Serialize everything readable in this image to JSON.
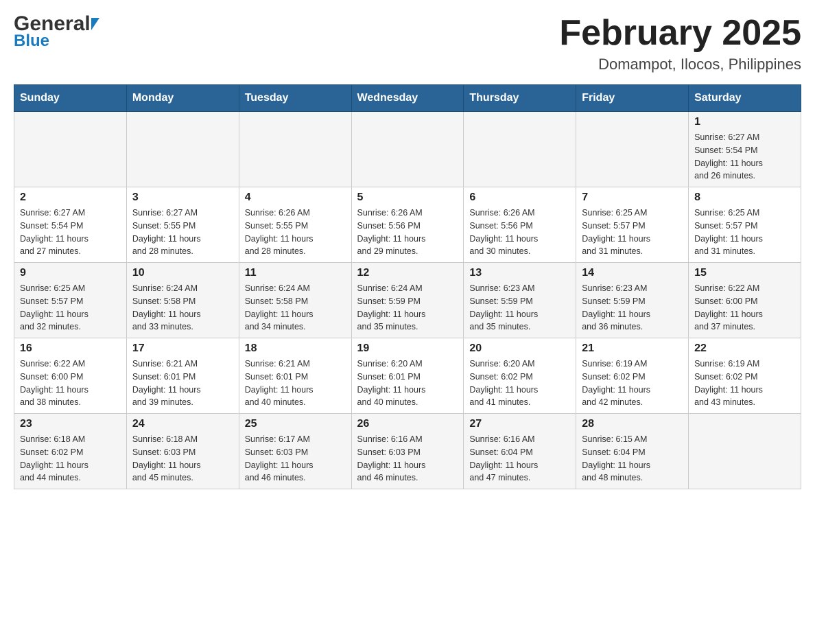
{
  "logo": {
    "general": "General",
    "blue": "Blue"
  },
  "header": {
    "month_year": "February 2025",
    "location": "Domampot, Ilocos, Philippines"
  },
  "weekdays": [
    "Sunday",
    "Monday",
    "Tuesday",
    "Wednesday",
    "Thursday",
    "Friday",
    "Saturday"
  ],
  "weeks": [
    {
      "days": [
        {
          "number": "",
          "info": ""
        },
        {
          "number": "",
          "info": ""
        },
        {
          "number": "",
          "info": ""
        },
        {
          "number": "",
          "info": ""
        },
        {
          "number": "",
          "info": ""
        },
        {
          "number": "",
          "info": ""
        },
        {
          "number": "1",
          "info": "Sunrise: 6:27 AM\nSunset: 5:54 PM\nDaylight: 11 hours\nand 26 minutes."
        }
      ]
    },
    {
      "days": [
        {
          "number": "2",
          "info": "Sunrise: 6:27 AM\nSunset: 5:54 PM\nDaylight: 11 hours\nand 27 minutes."
        },
        {
          "number": "3",
          "info": "Sunrise: 6:27 AM\nSunset: 5:55 PM\nDaylight: 11 hours\nand 28 minutes."
        },
        {
          "number": "4",
          "info": "Sunrise: 6:26 AM\nSunset: 5:55 PM\nDaylight: 11 hours\nand 28 minutes."
        },
        {
          "number": "5",
          "info": "Sunrise: 6:26 AM\nSunset: 5:56 PM\nDaylight: 11 hours\nand 29 minutes."
        },
        {
          "number": "6",
          "info": "Sunrise: 6:26 AM\nSunset: 5:56 PM\nDaylight: 11 hours\nand 30 minutes."
        },
        {
          "number": "7",
          "info": "Sunrise: 6:25 AM\nSunset: 5:57 PM\nDaylight: 11 hours\nand 31 minutes."
        },
        {
          "number": "8",
          "info": "Sunrise: 6:25 AM\nSunset: 5:57 PM\nDaylight: 11 hours\nand 31 minutes."
        }
      ]
    },
    {
      "days": [
        {
          "number": "9",
          "info": "Sunrise: 6:25 AM\nSunset: 5:57 PM\nDaylight: 11 hours\nand 32 minutes."
        },
        {
          "number": "10",
          "info": "Sunrise: 6:24 AM\nSunset: 5:58 PM\nDaylight: 11 hours\nand 33 minutes."
        },
        {
          "number": "11",
          "info": "Sunrise: 6:24 AM\nSunset: 5:58 PM\nDaylight: 11 hours\nand 34 minutes."
        },
        {
          "number": "12",
          "info": "Sunrise: 6:24 AM\nSunset: 5:59 PM\nDaylight: 11 hours\nand 35 minutes."
        },
        {
          "number": "13",
          "info": "Sunrise: 6:23 AM\nSunset: 5:59 PM\nDaylight: 11 hours\nand 35 minutes."
        },
        {
          "number": "14",
          "info": "Sunrise: 6:23 AM\nSunset: 5:59 PM\nDaylight: 11 hours\nand 36 minutes."
        },
        {
          "number": "15",
          "info": "Sunrise: 6:22 AM\nSunset: 6:00 PM\nDaylight: 11 hours\nand 37 minutes."
        }
      ]
    },
    {
      "days": [
        {
          "number": "16",
          "info": "Sunrise: 6:22 AM\nSunset: 6:00 PM\nDaylight: 11 hours\nand 38 minutes."
        },
        {
          "number": "17",
          "info": "Sunrise: 6:21 AM\nSunset: 6:01 PM\nDaylight: 11 hours\nand 39 minutes."
        },
        {
          "number": "18",
          "info": "Sunrise: 6:21 AM\nSunset: 6:01 PM\nDaylight: 11 hours\nand 40 minutes."
        },
        {
          "number": "19",
          "info": "Sunrise: 6:20 AM\nSunset: 6:01 PM\nDaylight: 11 hours\nand 40 minutes."
        },
        {
          "number": "20",
          "info": "Sunrise: 6:20 AM\nSunset: 6:02 PM\nDaylight: 11 hours\nand 41 minutes."
        },
        {
          "number": "21",
          "info": "Sunrise: 6:19 AM\nSunset: 6:02 PM\nDaylight: 11 hours\nand 42 minutes."
        },
        {
          "number": "22",
          "info": "Sunrise: 6:19 AM\nSunset: 6:02 PM\nDaylight: 11 hours\nand 43 minutes."
        }
      ]
    },
    {
      "days": [
        {
          "number": "23",
          "info": "Sunrise: 6:18 AM\nSunset: 6:02 PM\nDaylight: 11 hours\nand 44 minutes."
        },
        {
          "number": "24",
          "info": "Sunrise: 6:18 AM\nSunset: 6:03 PM\nDaylight: 11 hours\nand 45 minutes."
        },
        {
          "number": "25",
          "info": "Sunrise: 6:17 AM\nSunset: 6:03 PM\nDaylight: 11 hours\nand 46 minutes."
        },
        {
          "number": "26",
          "info": "Sunrise: 6:16 AM\nSunset: 6:03 PM\nDaylight: 11 hours\nand 46 minutes."
        },
        {
          "number": "27",
          "info": "Sunrise: 6:16 AM\nSunset: 6:04 PM\nDaylight: 11 hours\nand 47 minutes."
        },
        {
          "number": "28",
          "info": "Sunrise: 6:15 AM\nSunset: 6:04 PM\nDaylight: 11 hours\nand 48 minutes."
        },
        {
          "number": "",
          "info": ""
        }
      ]
    }
  ],
  "colors": {
    "header_bg": "#2a6496",
    "header_text": "#ffffff",
    "odd_row_bg": "#f5f5f5",
    "even_row_bg": "#ffffff"
  }
}
